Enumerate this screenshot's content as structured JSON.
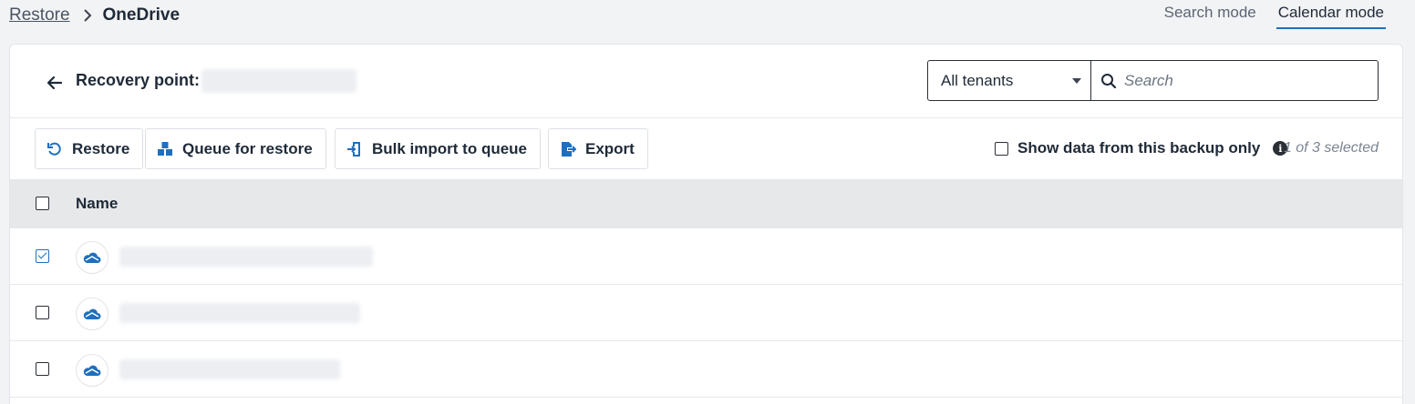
{
  "breadcrumb": {
    "root": "Restore",
    "current": "OneDrive"
  },
  "mode_tabs": [
    {
      "label": "Search mode",
      "active": false
    },
    {
      "label": "Calendar mode",
      "active": true
    }
  ],
  "header": {
    "recovery_label": "Recovery point:",
    "recovery_value": "",
    "tenant_select": "All tenants",
    "search_placeholder": "Search"
  },
  "toolbar": {
    "restore": "Restore",
    "queue": "Queue for restore",
    "bulk": "Bulk import to queue",
    "export": "Export",
    "show_data": "Show data from this backup only",
    "selection_count": "1 of 3 selected"
  },
  "table": {
    "column_name": "Name",
    "rows": [
      {
        "name": "",
        "checked": true
      },
      {
        "name": "",
        "checked": false
      },
      {
        "name": "",
        "checked": false
      }
    ]
  },
  "colors": {
    "accent": "#1e6fbf",
    "header_bg": "#e7e8ea"
  },
  "icons": [
    "chevron-right-icon",
    "back-arrow-icon",
    "search-icon",
    "restore-icon",
    "queue-icon",
    "bulk-import-icon",
    "export-icon",
    "info-icon",
    "onedrive-cloud-icon"
  ]
}
